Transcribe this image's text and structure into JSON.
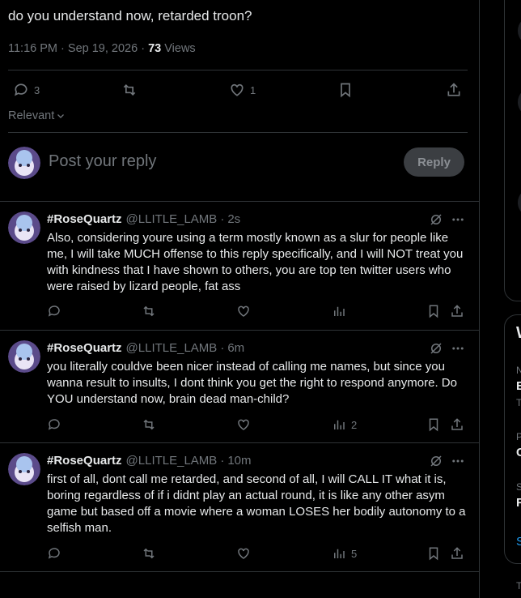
{
  "post": {
    "text": "do you understand now, retarded troon?",
    "time": "11:16 PM",
    "dot": "·",
    "date": "Sep 19, 2026",
    "views_count": "73",
    "views_label": "Views",
    "replies": "3",
    "likes": "1"
  },
  "filter": {
    "label": "Relevant"
  },
  "composer": {
    "placeholder": "Post your reply",
    "button": "Reply"
  },
  "replies": [
    {
      "name": "#RoseQuartz",
      "handle": "@LLITLE_LAMB",
      "dot": "·",
      "time": "2s",
      "text": "Also, considering youre using a term mostly known as a slur for people like me, I will take MUCH offense to this reply specifically, and I will NOT treat you with kindness that I have shown to others, you are top ten twitter users who were raised by lizard people, fat ass",
      "views": ""
    },
    {
      "name": "#RoseQuartz",
      "handle": "@LLITLE_LAMB",
      "dot": "·",
      "time": "6m",
      "text": "you literally couldve been nicer instead of calling me names, but since you wanna result to insults, I dont think you get the right to respond anymore. Do YOU understand now, brain dead man-child?",
      "views": "2"
    },
    {
      "name": "#RoseQuartz",
      "handle": "@LLITLE_LAMB",
      "dot": "·",
      "time": "10m",
      "text": "first of all, dont call me retarded, and second of all, I will CALL IT what it is, boring regardless of if i didnt play an actual round, it is like any other asym game but based off a movie where a woman LOSES her bodily autonomy to a selfish man.",
      "views": "5"
    }
  ],
  "sidebar_partial": {
    "letters": [
      "W",
      "N",
      "E",
      "T",
      "P",
      "C",
      "S",
      "F",
      "S",
      "T"
    ]
  },
  "colors": {
    "background": "#000000",
    "border": "#2f3336",
    "text": "#e7e9ea",
    "muted": "#71767b",
    "reply_button_bg": "#3b3e42",
    "link": "#1d9bf0"
  },
  "icons": [
    "reply-icon",
    "retweet-icon",
    "like-icon",
    "bookmark-icon",
    "share-icon",
    "analytics-icon",
    "grok-icon",
    "more-icon",
    "chevron-down-icon"
  ]
}
